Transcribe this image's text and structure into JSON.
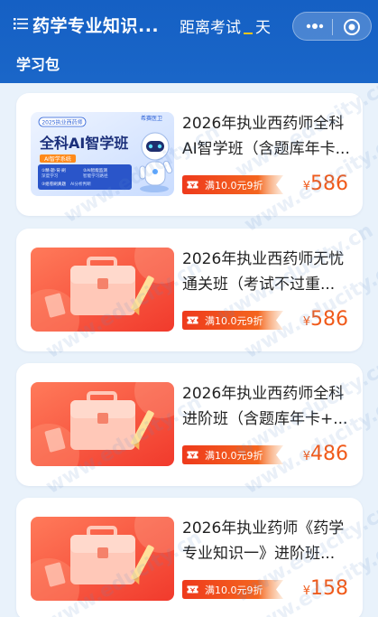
{
  "header": {
    "title": "药学专业知识...",
    "countdown_label": "距离考试",
    "countdown_unit": "天",
    "section_label": "学习包"
  },
  "thumbnail_texts": {
    "ai_class_badge": "2025执业西药师",
    "ai_class_brand": "希赛医卫",
    "ai_class_title": "全科AI智学班",
    "ai_class_tag": "AI智学系统",
    "ai_class_features": [
      "①精·题·背·刷",
      "深度学习",
      "②AI智能监测",
      "智能学习路径",
      "③组卷刷真题",
      "AI分析判断"
    ]
  },
  "courses": [
    {
      "title": "2026年执业西药师全科AI智学班（含题库年卡...",
      "coupon": "满10.0元9折",
      "currency": "¥",
      "price": "586",
      "thumb": "ai"
    },
    {
      "title": "2026年执业西药师无忧通关班（考试不过重...",
      "coupon": "满10.0元9折",
      "currency": "¥",
      "price": "586",
      "thumb": "bag"
    },
    {
      "title": "2026年执业西药师全科进阶班（含题库年卡+...",
      "coupon": "满10.0元9折",
      "currency": "¥",
      "price": "486",
      "thumb": "bag"
    },
    {
      "title": "2026年执业药师《药学专业知识一》进阶班...",
      "coupon": "满10.0元9折",
      "currency": "¥",
      "price": "158",
      "thumb": "bag"
    }
  ],
  "colors": {
    "accent": "#1a66c8",
    "price": "#f05a1a",
    "coupon": "#f04a1e"
  },
  "icons": [
    "list-menu-icon",
    "more-dots-icon",
    "close-target-icon",
    "ticket-icon"
  ],
  "watermark_text": "www.educity.cn"
}
